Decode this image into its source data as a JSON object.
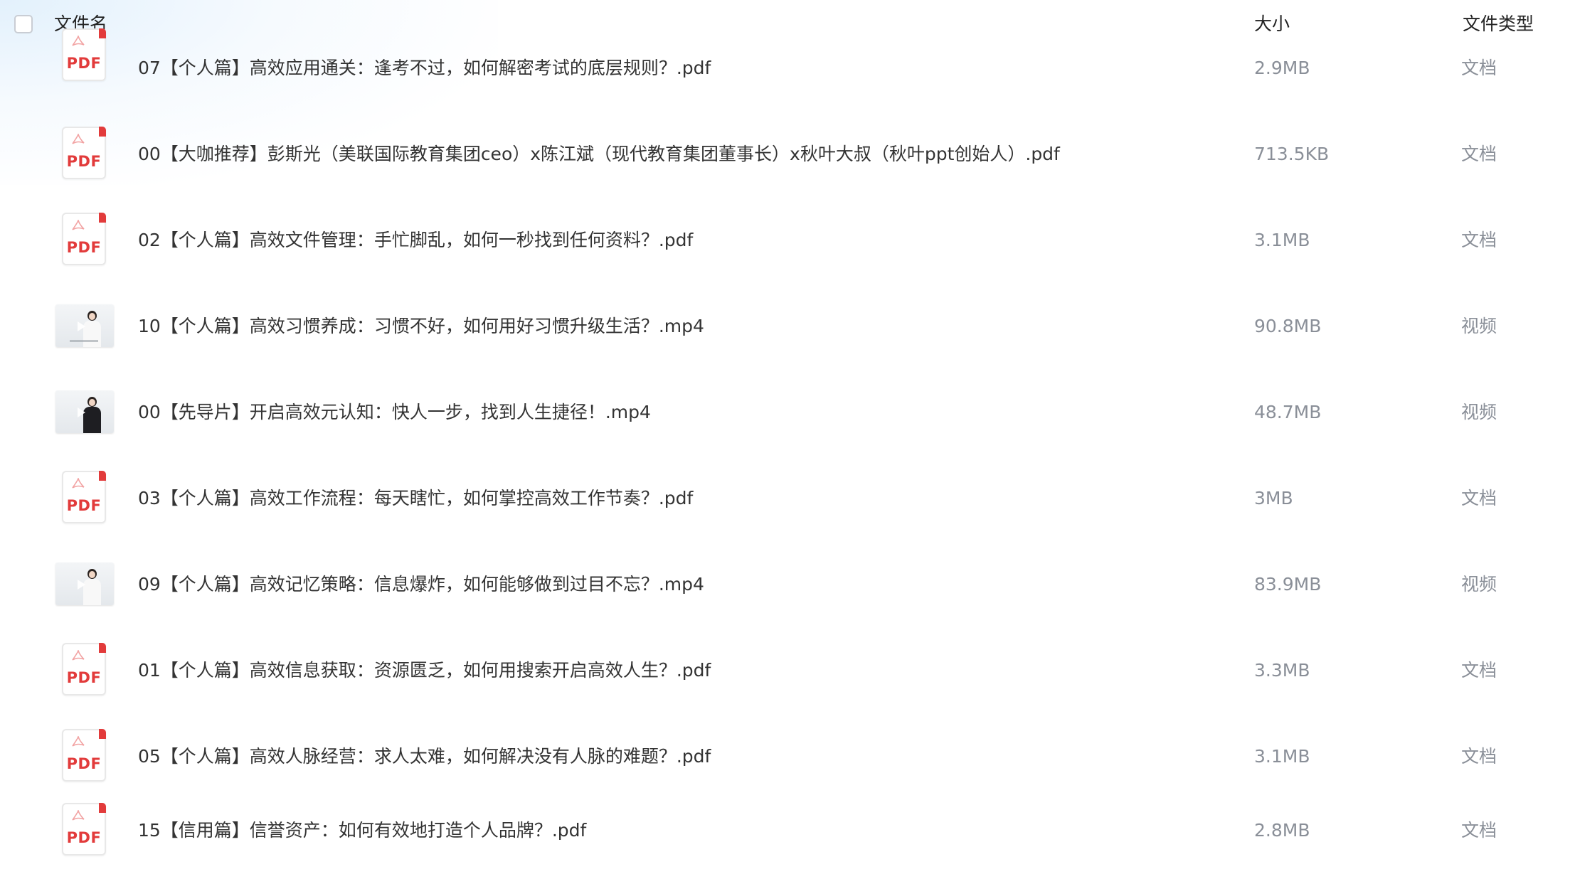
{
  "header": {
    "name_label": "文件名",
    "size_label": "大小",
    "type_label": "文件类型"
  },
  "icons": {
    "pdf_label": "PDF"
  },
  "files": [
    {
      "name": "07【个人篇】高效应用通关：逢考不过，如何解密考试的底层规则？.pdf",
      "size": "2.9MB",
      "type": "文档",
      "icon": "pdf-icon"
    },
    {
      "name": "00【大咖推荐】彭斯光（美联国际教育集团ceo）x陈江斌（现代教育集团董事长）x秋叶大叔（秋叶ppt创始人）.pdf",
      "size": "713.5KB",
      "type": "文档",
      "icon": "pdf-icon"
    },
    {
      "name": "02【个人篇】高效文件管理：手忙脚乱，如何一秒找到任何资料？.pdf",
      "size": "3.1MB",
      "type": "文档",
      "icon": "pdf-icon"
    },
    {
      "name": "10【个人篇】高效习惯养成：习惯不好，如何用好习惯升级生活？.mp4",
      "size": "90.8MB",
      "type": "视频",
      "icon": "video-thumbnail"
    },
    {
      "name": "00【先导片】开启高效元认知：快人一步，找到人生捷径！.mp4",
      "size": "48.7MB",
      "type": "视频",
      "icon": "video-thumbnail"
    },
    {
      "name": "03【个人篇】高效工作流程：每天瞎忙，如何掌控高效工作节奏？.pdf",
      "size": "3MB",
      "type": "文档",
      "icon": "pdf-icon"
    },
    {
      "name": "09【个人篇】高效记忆策略：信息爆炸，如何能够做到过目不忘？.mp4",
      "size": "83.9MB",
      "type": "视频",
      "icon": "video-thumbnail"
    },
    {
      "name": "01【个人篇】高效信息获取：资源匮乏，如何用搜索开启高效人生？.pdf",
      "size": "3.3MB",
      "type": "文档",
      "icon": "pdf-icon"
    },
    {
      "name": "05【个人篇】高效人脉经营：求人太难，如何解决没有人脉的难题？.pdf",
      "size": "3.1MB",
      "type": "文档",
      "icon": "pdf-icon"
    },
    {
      "name": "15【信用篇】信誉资产：如何有效地打造个人品牌？.pdf",
      "size": "2.8MB",
      "type": "文档",
      "icon": "pdf-icon"
    }
  ],
  "colors": {
    "pdf_red": "#e23b3b",
    "text_primary": "#333333",
    "text_secondary": "#8a8f98"
  }
}
